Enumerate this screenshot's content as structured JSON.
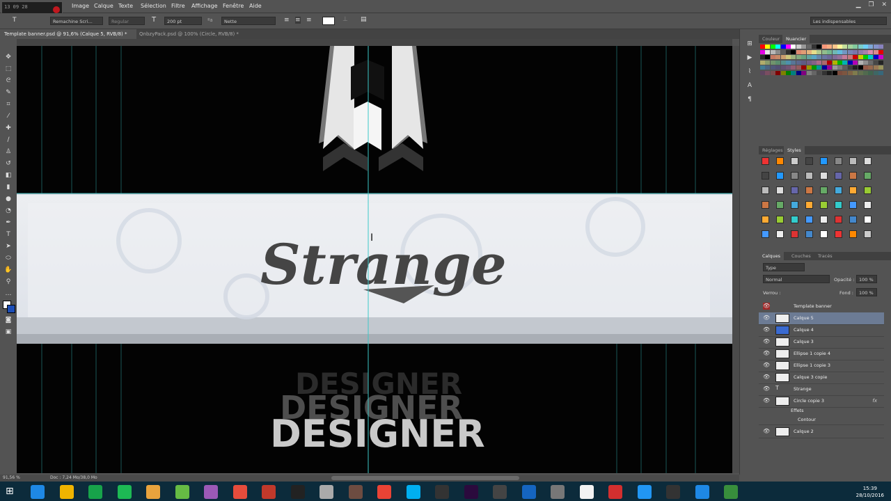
{
  "app": {
    "menu": [
      "Image",
      "Calque",
      "Texte",
      "Sélection",
      "Filtre",
      "Affichage",
      "Fenêtre",
      "Aide"
    ],
    "window_controls": [
      "▁",
      "❐",
      "✕"
    ]
  },
  "recorder": {
    "time": "13 09 28"
  },
  "options": {
    "font_family": "Remachine Scri…",
    "font_style": "Regular",
    "font_size": "200 pt",
    "antialias": "Nette",
    "workspace": "Les indispensables"
  },
  "tabs": [
    {
      "label": "Template banner.psd @ 91,6% (Calque 5, RVB/8) *",
      "active": true
    },
    {
      "label": "QnbzyPack.psd @ 100% (Circle, RVB/8) *",
      "active": false
    }
  ],
  "canvas": {
    "logo_text": "Strange",
    "designer_text": "DESIGNER",
    "colors": {
      "band": "#e9ecf1",
      "guide": "#2a9a9a"
    }
  },
  "status": {
    "zoom": "91,56 %",
    "doc": "Doc : 7,24 Mo/38,0 Mo"
  },
  "panels": {
    "color_tabs": [
      "Couleur",
      "Nuancier"
    ],
    "style_tabs": [
      "Réglages",
      "Styles"
    ],
    "layer_tabs": [
      "Calques",
      "Couches",
      "Tracés"
    ],
    "filter_kind": "Type",
    "blend_mode": "Normal",
    "opacity_label": "Opacité :",
    "opacity": "100 %",
    "lock_label": "Verrou :",
    "fill_label": "Fond :",
    "fill": "100 %",
    "layers": [
      {
        "name": "Template banner",
        "group": true,
        "selected": false,
        "fx": ""
      },
      {
        "name": "Calque 5",
        "selected": true,
        "fx": ""
      },
      {
        "name": "Calque 4",
        "selected": false,
        "fx": ""
      },
      {
        "name": "Calque 3",
        "selected": false,
        "fx": ""
      },
      {
        "name": "Ellipse 1 copie 4",
        "selected": false,
        "fx": ""
      },
      {
        "name": "Ellipse 1 copie 3",
        "selected": false,
        "fx": ""
      },
      {
        "name": "Calque 3 copie",
        "selected": false,
        "fx": ""
      },
      {
        "name": "Strange",
        "selected": false,
        "fx": "",
        "text_layer": true
      },
      {
        "name": "Circle copie 3",
        "selected": false,
        "fx": "fx"
      },
      {
        "name": "Effets",
        "selected": false,
        "fx": "",
        "sub": true
      },
      {
        "name": "Contour",
        "selected": false,
        "fx": "",
        "sub": true
      },
      {
        "name": "Calque 2",
        "selected": false,
        "fx": ""
      }
    ]
  },
  "taskbar": {
    "time": "15:39",
    "date": "28/10/2016"
  }
}
